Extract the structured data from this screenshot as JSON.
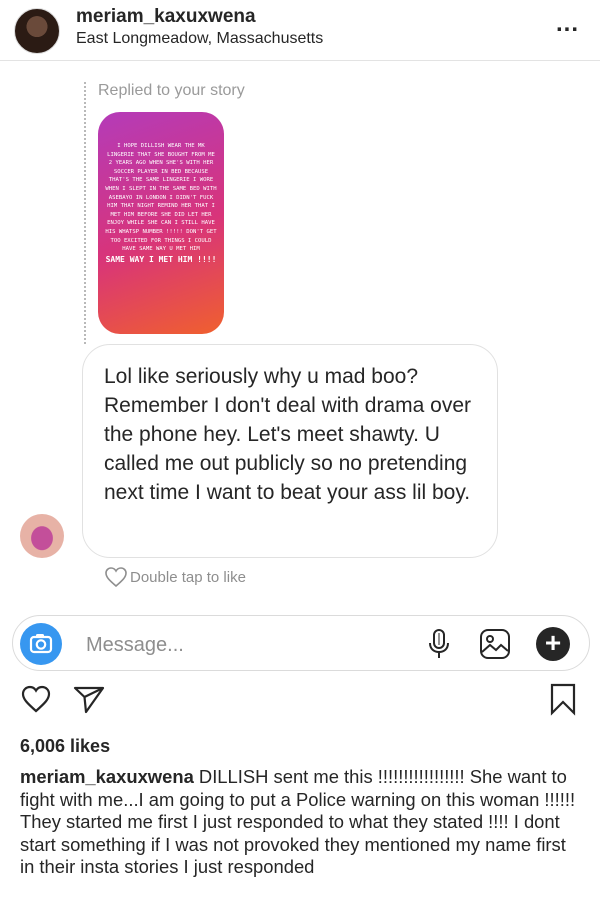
{
  "header": {
    "username": "meriam_kaxuxwena",
    "location": "East Longmeadow, Massachusetts",
    "more": "..."
  },
  "reply": {
    "label": "Replied to your story",
    "story_text": "I HOPE DILLISH WEAR THE MK LINGERIE THAT SHE BOUGHT FROM ME 2 YEARS AGO WHEN SHE'S WITH HER SOCCER PLAYER IN BED BECAUSE THAT'S THE SAME LINGERIE I WORE WHEN I SLEPT IN THE SAME BED WITH ASEBAYO IN LONDON I DIDN'T FUCK HIM THAT NIGHT REMIND HER THAT I MET HIM BEFORE SHE DID LET HER ENJOY WHILE SHE CAN I STILL HAVE HIS WHATSP NUMBER !!!!! DON'T GET TOO EXCITED FOR THINGS I COULD HAVE SAME WAY U MET HIM",
    "story_text_end": "SAME WAY I MET HIM !!!!"
  },
  "message": {
    "text": "Lol like seriously why u mad boo? Remember I don't deal with drama over the phone hey. Let's meet shawty. U called me out publicly so no pretending next time I want to beat your ass lil boy.",
    "like_hint": "Double tap to like"
  },
  "composer": {
    "placeholder": "Message..."
  },
  "post": {
    "likes": "6,006 likes",
    "caption_user": "meriam_kaxuxwena",
    "caption_text": " DILLISH sent me this !!!!!!!!!!!!!!!!! She want to fight with me...I am going to put  a Police warning on this woman !!!!!! They started me first  I just responded to what they stated !!!! I dont start something if I was not provoked they mentioned my name first in their insta stories I just responded"
  },
  "icons": {
    "camera": "camera-icon",
    "mic": "microphone-icon",
    "gallery": "gallery-icon",
    "plus": "plus-icon",
    "heart": "heart-icon",
    "share": "share-icon",
    "bookmark": "bookmark-icon"
  },
  "colors": {
    "accent": "#3797f0",
    "story_gradient_start": "#b43bb9",
    "story_gradient_end": "#f0602e"
  }
}
